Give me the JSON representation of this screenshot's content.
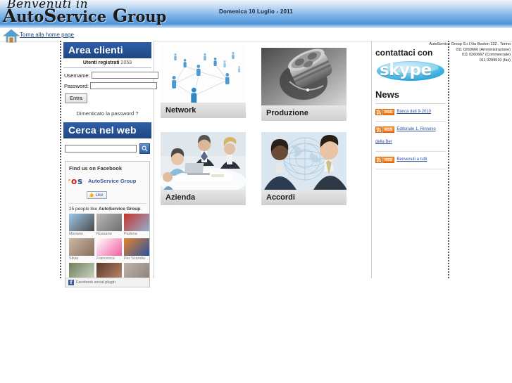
{
  "header": {
    "logo_line1": "Benvenuti in",
    "logo_line2_a": "A",
    "logo_line2_b": "uto",
    "logo_line2_c": "S",
    "logo_line2_d": "ervice",
    "logo_line2_e": "G",
    "logo_line2_f": "roup",
    "date": "Domenica 10 Luglio - 2011"
  },
  "homebar": {
    "link": "Torna alla home page",
    "icon": "house-icon"
  },
  "login": {
    "panel_title": "Area clienti",
    "registered_label": "Utenti registrati",
    "registered_count": "2059",
    "username_label": "Username:",
    "username_value": "",
    "password_label": "Password:",
    "password_value": "",
    "submit_label": "Entra",
    "forgot_label": "Dimenticato la password ?"
  },
  "search": {
    "panel_title": "Cerca nel web",
    "value": "",
    "placeholder": "",
    "button_icon": "search-icon"
  },
  "facebook": {
    "title": "Find us on Facebook",
    "page_name": "AutoService Group",
    "like_label": "Like",
    "like_icon": "thumbs-up-icon",
    "count_prefix": "25 people like",
    "count_page": "AutoService Group",
    "count_suffix": ".",
    "faces": [
      {
        "name": "Mariano",
        "color1": "#9ec8e8",
        "color2": "#4a4a4a"
      },
      {
        "name": "Rossano",
        "color1": "#b9b9b9",
        "color2": "#6e6e6e"
      },
      {
        "name": "Padova",
        "color1": "#c9322a",
        "color2": "#8fb3d2"
      },
      {
        "name": "Silvia",
        "color1": "#cbb6a4",
        "color2": "#8a6f5c"
      },
      {
        "name": "Francesca",
        "color1": "#ffffff",
        "color2": "#f05fa0"
      },
      {
        "name": "Per Scandia",
        "color1": "#e4842c",
        "color2": "#2a53a0"
      }
    ],
    "faces_row3": [
      {
        "color1": "#6f7f5b",
        "color2": "#cfd8c8"
      },
      {
        "color1": "#5a3a2c",
        "color2": "#c08a6a"
      },
      {
        "color1": "#bdb4aa",
        "color2": "#8c8178"
      }
    ],
    "footer": "Facebook social plugin",
    "footer_badge": "f"
  },
  "tiles": [
    {
      "caption": "Network",
      "theme": "network"
    },
    {
      "caption": "Produzione",
      "theme": "produzione"
    },
    {
      "caption": "Azienda",
      "theme": "azienda"
    },
    {
      "caption": "Accordi",
      "theme": "accordi"
    }
  ],
  "right": {
    "contact_heading": "contattaci con",
    "skype_label": "skype",
    "skype_tm": "™",
    "news_heading": "News",
    "rss_label": "RSS",
    "news_items": [
      "Banca dati 9-2010",
      "Editoriale 1. Rinnovo della Ber",
      "Benvenuti a tutti"
    ]
  },
  "contact_info": {
    "line1": "AutoService Group S.r.l.Via Boston 132 . Torino",
    "line2": "011 0260666 (Amministrazione)",
    "line3": "011 0260667 (Commerciale)",
    "line4": "011 0209510 (fax)"
  }
}
